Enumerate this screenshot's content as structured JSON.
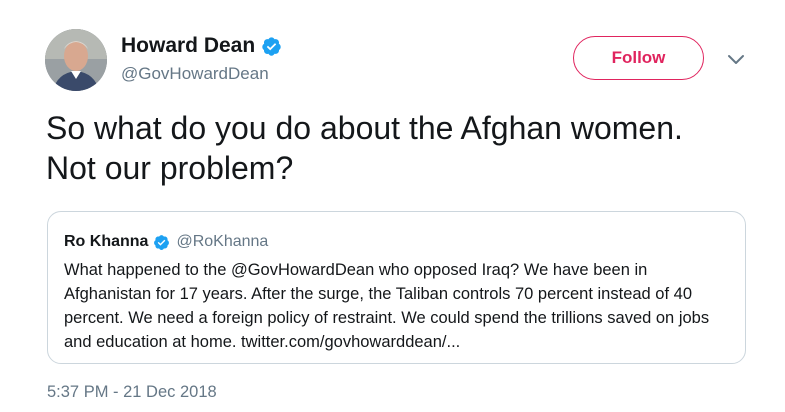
{
  "author": {
    "display_name": "Howard Dean",
    "handle": "@GovHowardDean",
    "verified": true
  },
  "follow_button": {
    "label": "Follow"
  },
  "tweet": {
    "text_line1": "So what do you do about the Afghan women.",
    "text_line2": "Not our problem?"
  },
  "quoted_tweet": {
    "display_name": "Ro Khanna",
    "handle": "@RoKhanna",
    "verified": true,
    "text": "What happened to the @GovHowardDean who opposed Iraq? We have been in Afghanistan for 17 years. After the surge, the Taliban controls 70 percent instead of 40 percent. We need a foreign policy of restraint. We could spend the trillions saved on jobs and education at home. twitter.com/govhowarddean/..."
  },
  "timestamp": "5:37 PM - 21 Dec 2018",
  "colors": {
    "follow_accent": "#e0245e",
    "verified_blue": "#1da1f2",
    "secondary_text": "#657786",
    "border": "#ccd6dd"
  },
  "icons": {
    "verified": "verified-badge-icon",
    "more": "chevron-down-icon"
  }
}
